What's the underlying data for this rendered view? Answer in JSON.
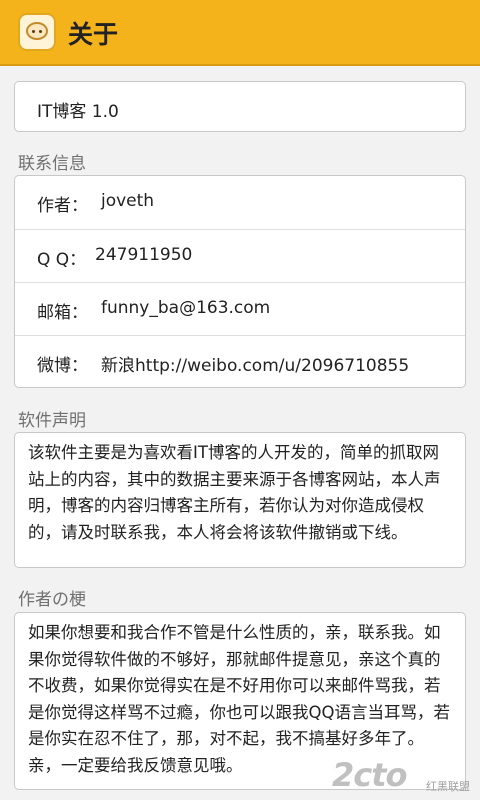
{
  "header": {
    "title": "关于",
    "icon": "app-logo-icon",
    "color": "#f4b21b"
  },
  "app_version": "IT博客 1.0",
  "contact": {
    "section_label": "联系信息",
    "rows": [
      {
        "label": "作者：",
        "value": "joveth"
      },
      {
        "label": "Q Q：",
        "value": "247911950"
      },
      {
        "label": "邮箱：",
        "value": "funny_ba@163.com"
      },
      {
        "label": "微博：",
        "value": "新浪http://weibo.com/u/2096710855"
      }
    ]
  },
  "statement": {
    "section_label": "软件声明",
    "text": "该软件主要是为喜欢看IT博客的人开发的，简单的抓取网站上的内容，其中的数据主要来源于各博客网站，本人声明，博客的内容归博客主所有，若你认为对你造成侵权的，请及时联系我，本人将会将该软件撤销或下线。"
  },
  "author_joke": {
    "section_label": "作者の梗",
    "text": "如果你想要和我合作不管是什么性质的，亲，联系我。如果你觉得软件做的不够好，那就邮件提意见，亲这个真的不收费，如果你觉得实在是不好用你可以来邮件骂我，若是你觉得这样骂不过瘾，你也可以跟我QQ语言当耳骂，若是你实在忍不住了，那，对不起，我不搞基好多年了。亲，一定要给我反馈意见哦。"
  },
  "watermark": {
    "logo": "2cto",
    "sub": "红黑联盟"
  }
}
